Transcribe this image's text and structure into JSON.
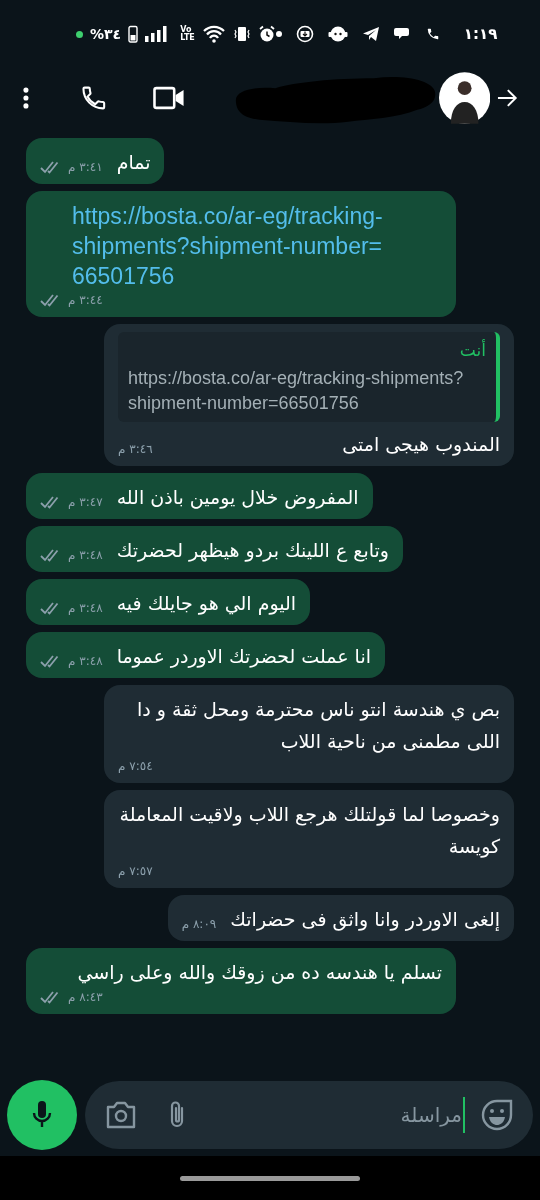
{
  "status_bar": {
    "time": "١:١٩",
    "battery": "%٣٤",
    "volte": {
      "top": "Vo",
      "bottom": "LTE"
    }
  },
  "messages": [
    {
      "kind": "out",
      "text": "تمام",
      "time": "٣:٤١ م"
    },
    {
      "kind": "out",
      "link": "https://bosta.co/ar-eg/tracking-shipments?shipment-number=66501756",
      "time": "٣:٤٤ م"
    },
    {
      "kind": "in",
      "quote": {
        "sender": "أنت",
        "text": "https://bosta.co/ar-eg/tracking-shipments?shipment-number=66501756"
      },
      "text": "المندوب هيجى امتى",
      "time": "٣:٤٦ م"
    },
    {
      "kind": "out",
      "text": "المفروض خلال يومين باذن الله",
      "time": "٣:٤٧ م"
    },
    {
      "kind": "out",
      "text": "وتابع ع اللينك بردو هيظهر لحضرتك",
      "time": "٣:٤٨ م"
    },
    {
      "kind": "out",
      "text": "اليوم الي هو جايلك فيه",
      "time": "٣:٤٨ م"
    },
    {
      "kind": "out",
      "text": "انا عملت لحضرتك الاوردر عموما",
      "time": "٣:٤٨ م"
    },
    {
      "kind": "in",
      "text": "بص ي هندسة انتو ناس محترمة ومحل ثقة و دا اللى مطمنى من ناحية اللاب",
      "time": "٧:٥٤ م"
    },
    {
      "kind": "in",
      "text": "وخصوصا لما قولتلك هرجع اللاب ولاقيت المعاملة كويسة",
      "time": "٧:٥٧ م"
    },
    {
      "kind": "in",
      "text": "إلغى الاوردر وانا واثق فى حضراتك",
      "time": "٨:٠٩ م"
    },
    {
      "kind": "out",
      "text": "تسلم يا هندسه ده من زوقك والله وعلى راسي",
      "time": "٨:٤٣ م"
    }
  ],
  "composer": {
    "placeholder": "مراسلة"
  }
}
